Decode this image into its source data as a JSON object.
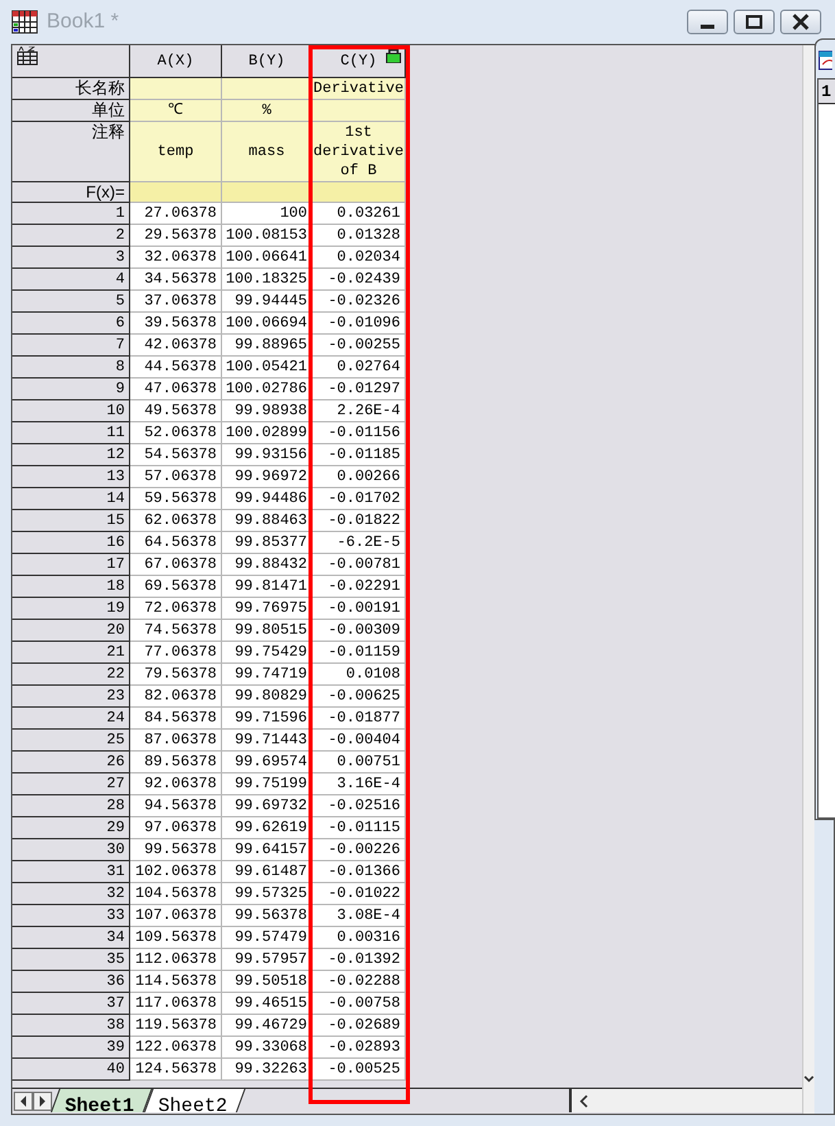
{
  "window": {
    "title": "Book1 *",
    "active": false
  },
  "meta_labels": [
    "长名称",
    "单位",
    "注释",
    "F(x)="
  ],
  "columns": [
    {
      "header": "A(X)",
      "units": "℃",
      "comments": "temp",
      "highlighted": false
    },
    {
      "header": "B(Y)",
      "units": "%",
      "comments": "mass",
      "highlighted": false
    },
    {
      "header": "C(Y)",
      "long_name": "Derivative",
      "comments": "1st derivative of B",
      "highlighted": true
    }
  ],
  "rows": [
    {
      "n": "1",
      "cells": [
        "27.06378",
        "100",
        "0.03261"
      ]
    },
    {
      "n": "2",
      "cells": [
        "29.56378",
        "100.08153",
        "0.01328"
      ]
    },
    {
      "n": "3",
      "cells": [
        "32.06378",
        "100.06641",
        "0.02034"
      ]
    },
    {
      "n": "4",
      "cells": [
        "34.56378",
        "100.18325",
        "-0.02439"
      ]
    },
    {
      "n": "5",
      "cells": [
        "37.06378",
        "99.94445",
        "-0.02326"
      ]
    },
    {
      "n": "6",
      "cells": [
        "39.56378",
        "100.06694",
        "-0.01096"
      ]
    },
    {
      "n": "7",
      "cells": [
        "42.06378",
        "99.88965",
        "-0.00255"
      ]
    },
    {
      "n": "8",
      "cells": [
        "44.56378",
        "100.05421",
        "0.02764"
      ]
    },
    {
      "n": "9",
      "cells": [
        "47.06378",
        "100.02786",
        "-0.01297"
      ]
    },
    {
      "n": "10",
      "cells": [
        "49.56378",
        "99.98938",
        "2.26E-4"
      ]
    },
    {
      "n": "11",
      "cells": [
        "52.06378",
        "100.02899",
        "-0.01156"
      ]
    },
    {
      "n": "12",
      "cells": [
        "54.56378",
        "99.93156",
        "-0.01185"
      ]
    },
    {
      "n": "13",
      "cells": [
        "57.06378",
        "99.96972",
        "0.00266"
      ]
    },
    {
      "n": "14",
      "cells": [
        "59.56378",
        "99.94486",
        "-0.01702"
      ]
    },
    {
      "n": "15",
      "cells": [
        "62.06378",
        "99.88463",
        "-0.01822"
      ]
    },
    {
      "n": "16",
      "cells": [
        "64.56378",
        "99.85377",
        "-6.2E-5"
      ]
    },
    {
      "n": "17",
      "cells": [
        "67.06378",
        "99.88432",
        "-0.00781"
      ]
    },
    {
      "n": "18",
      "cells": [
        "69.56378",
        "99.81471",
        "-0.02291"
      ]
    },
    {
      "n": "19",
      "cells": [
        "72.06378",
        "99.76975",
        "-0.00191"
      ]
    },
    {
      "n": "20",
      "cells": [
        "74.56378",
        "99.80515",
        "-0.00309"
      ]
    },
    {
      "n": "21",
      "cells": [
        "77.06378",
        "99.75429",
        "-0.01159"
      ]
    },
    {
      "n": "22",
      "cells": [
        "79.56378",
        "99.74719",
        "0.0108"
      ]
    },
    {
      "n": "23",
      "cells": [
        "82.06378",
        "99.80829",
        "-0.00625"
      ]
    },
    {
      "n": "24",
      "cells": [
        "84.56378",
        "99.71596",
        "-0.01877"
      ]
    },
    {
      "n": "25",
      "cells": [
        "87.06378",
        "99.71443",
        "-0.00404"
      ]
    },
    {
      "n": "26",
      "cells": [
        "89.56378",
        "99.69574",
        "0.00751"
      ]
    },
    {
      "n": "27",
      "cells": [
        "92.06378",
        "99.75199",
        "3.16E-4"
      ]
    },
    {
      "n": "28",
      "cells": [
        "94.56378",
        "99.69732",
        "-0.02516"
      ]
    },
    {
      "n": "29",
      "cells": [
        "97.06378",
        "99.62619",
        "-0.01115"
      ]
    },
    {
      "n": "30",
      "cells": [
        "99.56378",
        "99.64157",
        "-0.00226"
      ]
    },
    {
      "n": "31",
      "cells": [
        "102.06378",
        "99.61487",
        "-0.01366"
      ]
    },
    {
      "n": "32",
      "cells": [
        "104.56378",
        "99.57325",
        "-0.01022"
      ]
    },
    {
      "n": "33",
      "cells": [
        "107.06378",
        "99.56378",
        "3.08E-4"
      ]
    },
    {
      "n": "34",
      "cells": [
        "109.56378",
        "99.57479",
        "0.00316"
      ]
    },
    {
      "n": "35",
      "cells": [
        "112.06378",
        "99.57957",
        "-0.01392"
      ]
    },
    {
      "n": "36",
      "cells": [
        "114.56378",
        "99.50518",
        "-0.02288"
      ]
    },
    {
      "n": "37",
      "cells": [
        "117.06378",
        "99.46515",
        "-0.00758"
      ]
    },
    {
      "n": "38",
      "cells": [
        "119.56378",
        "99.46729",
        "-0.02689"
      ]
    },
    {
      "n": "39",
      "cells": [
        "122.06378",
        "99.33068",
        "-0.02893"
      ]
    },
    {
      "n": "40",
      "cells": [
        "124.56378",
        "99.32263",
        "-0.00525"
      ]
    }
  ],
  "sheet_tabs": [
    {
      "label": "Sheet1",
      "selected": true
    },
    {
      "label": "Sheet2",
      "selected": false
    }
  ],
  "other_window": {
    "row_header": "1"
  }
}
